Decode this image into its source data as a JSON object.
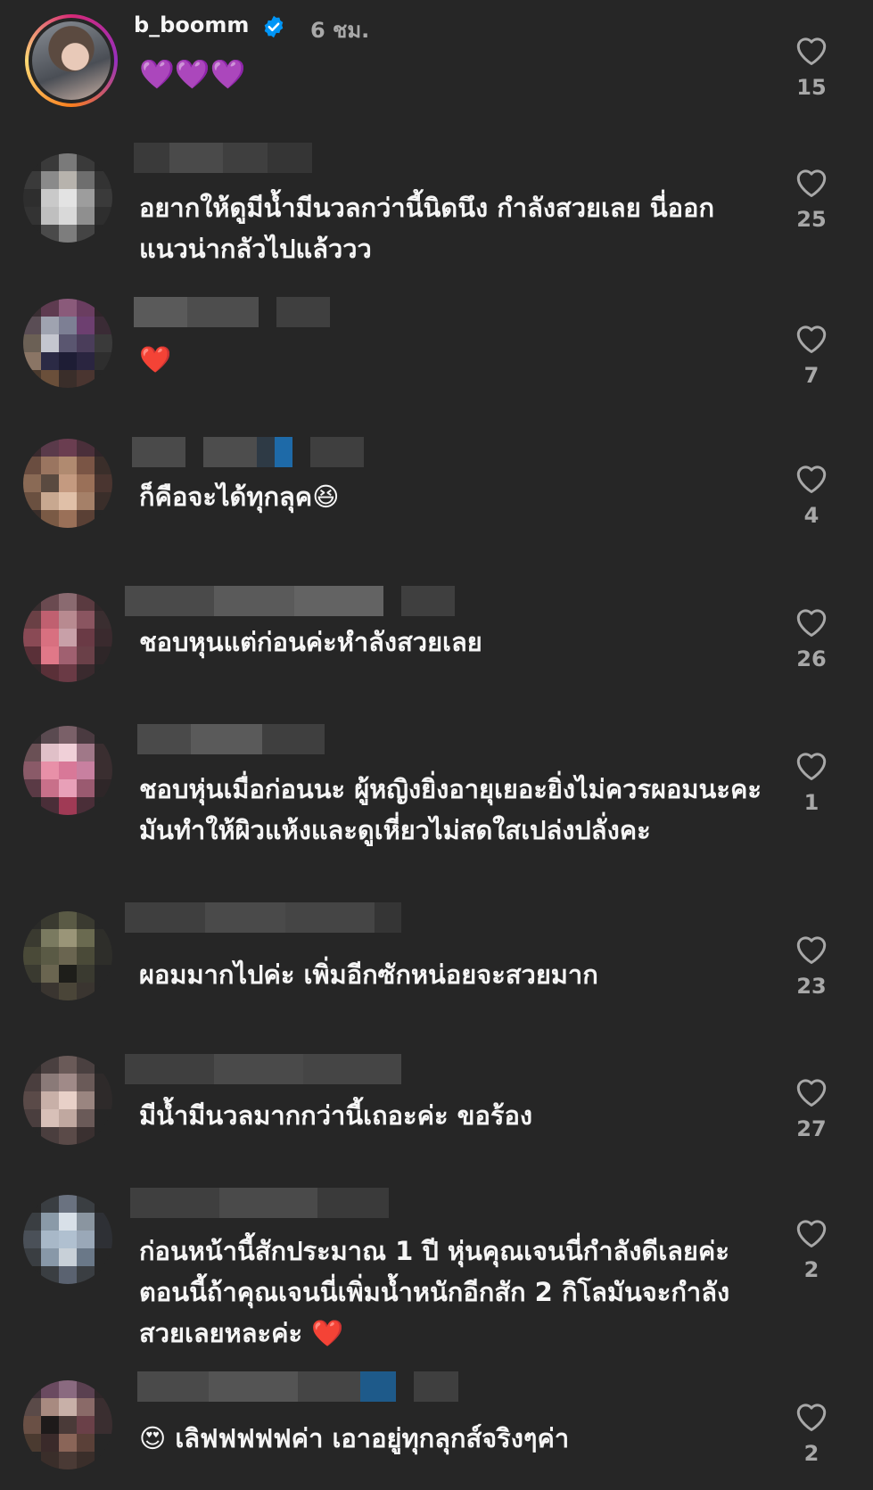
{
  "post_author": {
    "username": "b_boomm",
    "time": "6 ชม.",
    "comment": "💜💜💜",
    "likes": "15"
  },
  "comments": [
    {
      "text": "อยากให้ดูมีน้ำมีนวลกว่านี้นิดนึง กำลังสวยเลย นี่ออกแนวน่ากลัวไปแล้ววว",
      "likes": "25"
    },
    {
      "text": "❤️",
      "likes": "7"
    },
    {
      "text": "ก็คือจะได้ทุกลุค😆",
      "likes": "4"
    },
    {
      "text": "ชอบหุนแต่ก่อนค่ะหำลังสวยเลย",
      "likes": "26"
    },
    {
      "text": "ชอบหุ่นเมื่อก่อนนะ ผู้หญิงยิ่งอายุเยอะยิ่งไม่ควรผอมนะคะมันทำให้ผิวแห้งและดูเหี่ยวไม่สดใสเปล่งปลั่งคะ",
      "likes": "1"
    },
    {
      "text": "ผอมมากไปค่ะ  เพิ่มอีกซักหน่อยจะสวยมาก",
      "likes": "23"
    },
    {
      "text": "มีน้ำมีนวลมากกว่านี้เถอะค่ะ  ขอร้อง",
      "likes": "27"
    },
    {
      "text": "ก่อนหน้านี้สักประมาณ 1 ปี หุ่นคุณเจนนี่กำลังดีเลยค่ะ ตอนนี้ถ้าคุณเจนนี่เพิ่มน้ำหนักอีกสัก 2 กิโลมันจะกำลังสวยเลยหละค่ะ ❤️",
      "likes": "2"
    },
    {
      "text": "😍 เลิฟฟฟฟฟค่า เอาอยู่ทุกลุกส์จริงๆค่า",
      "likes": "2"
    }
  ],
  "colors": {
    "background": "#262626",
    "text": "#f5f5f5",
    "secondary": "#a8a8a8",
    "verified": "#0095f6"
  },
  "icons": [
    "verified-badge-icon",
    "heart-icon"
  ]
}
